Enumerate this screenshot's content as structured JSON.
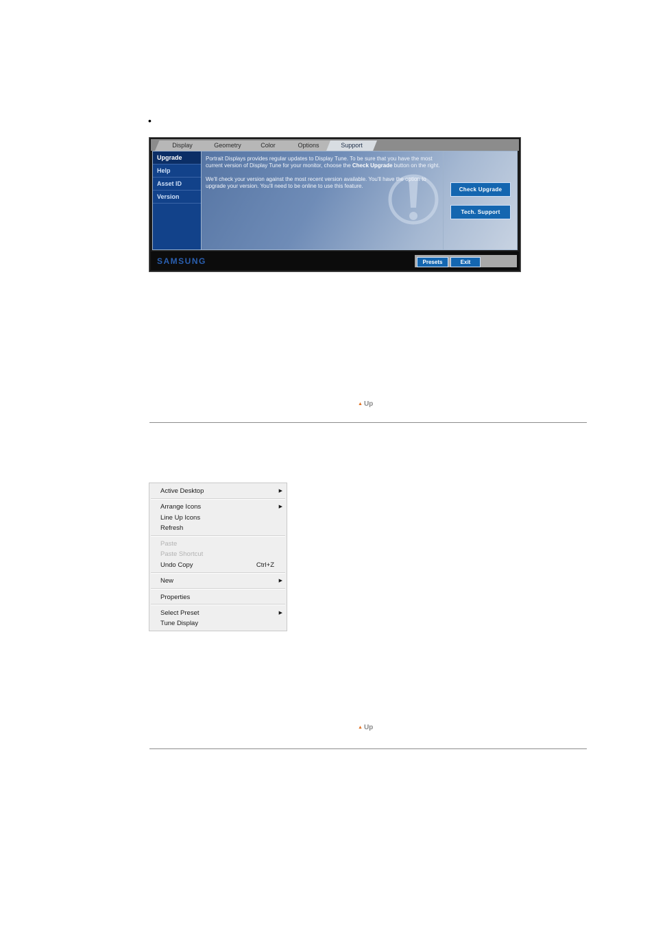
{
  "bullet": "•",
  "tune_window": {
    "tabs": [
      {
        "label": "Display"
      },
      {
        "label": "Geometry"
      },
      {
        "label": "Color"
      },
      {
        "label": "Options"
      },
      {
        "label": "Support"
      }
    ],
    "active_tab": "Support",
    "sidebar": [
      {
        "label": "Upgrade"
      },
      {
        "label": "Help"
      },
      {
        "label": "Asset ID"
      },
      {
        "label": "Version"
      }
    ],
    "active_sidebar": "Upgrade",
    "content": {
      "p1_pre": "Portrait Displays provides regular updates to Display Tune. To be sure that you have the most current version of Display Tune for your monitor, choose the ",
      "p1_bold": "Check Upgrade",
      "p1_post": " button on the right.",
      "p2": "We'll check your version against the most recent version available. You'll have the option to upgrade your version. You'll need to be online to use this feature."
    },
    "buttons": {
      "check_upgrade": "Check Upgrade",
      "tech_support": "Tech. Support"
    },
    "footer": {
      "brand": "SAMSUNG",
      "presets": "Presets",
      "exit": "Exit"
    }
  },
  "up_link_1": {
    "arrow": "▲",
    "label": "Up"
  },
  "up_link_2": {
    "arrow": "▲",
    "label": "Up"
  },
  "context_menu": {
    "active_desktop": "Active Desktop",
    "arrange_icons": "Arrange Icons",
    "line_up_icons": "Line Up Icons",
    "refresh": "Refresh",
    "paste": "Paste",
    "paste_shortcut": "Paste Shortcut",
    "undo_copy": "Undo Copy",
    "undo_copy_shortcut": "Ctrl+Z",
    "new": "New",
    "properties": "Properties",
    "select_preset": "Select Preset",
    "tune_display": "Tune Display",
    "submenu_arrow": "▶"
  }
}
